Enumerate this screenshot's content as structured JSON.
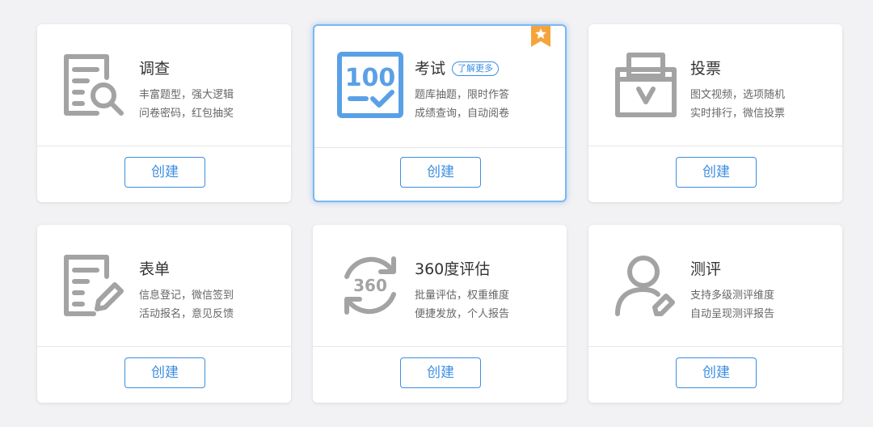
{
  "cards": [
    {
      "title": "调查",
      "desc": [
        "丰富题型，强大逻辑",
        "问卷密码，红包抽奖"
      ],
      "button": "创建",
      "icon": "survey-magnifier-icon"
    },
    {
      "title": "考试",
      "tag": "了解更多",
      "desc": [
        "题库抽题，限时作答",
        "成绩查询，自动阅卷"
      ],
      "button": "创建",
      "icon": "exam-100-icon",
      "icon_text": "100",
      "badge": "star-badge-icon"
    },
    {
      "title": "投票",
      "desc": [
        "图文视频，选项随机",
        "实时排行，微信投票"
      ],
      "button": "创建",
      "icon": "ballot-box-icon"
    },
    {
      "title": "表单",
      "desc": [
        "信息登记，微信签到",
        "活动报名，意见反馈"
      ],
      "button": "创建",
      "icon": "form-pencil-icon"
    },
    {
      "title": "360度评估",
      "desc": [
        "批量评估，权重维度",
        "便捷发放，个人报告"
      ],
      "button": "创建",
      "icon": "360-refresh-icon",
      "icon_text": "360"
    },
    {
      "title": "测评",
      "desc": [
        "支持多级测评维度",
        "自动呈现测评报告"
      ],
      "button": "创建",
      "icon": "person-pen-icon"
    }
  ],
  "colors": {
    "accent": "#3c8ee0",
    "icon_gray": "#a3a3a3",
    "badge_orange": "#f5a43c",
    "background": "#f2f2f4"
  }
}
